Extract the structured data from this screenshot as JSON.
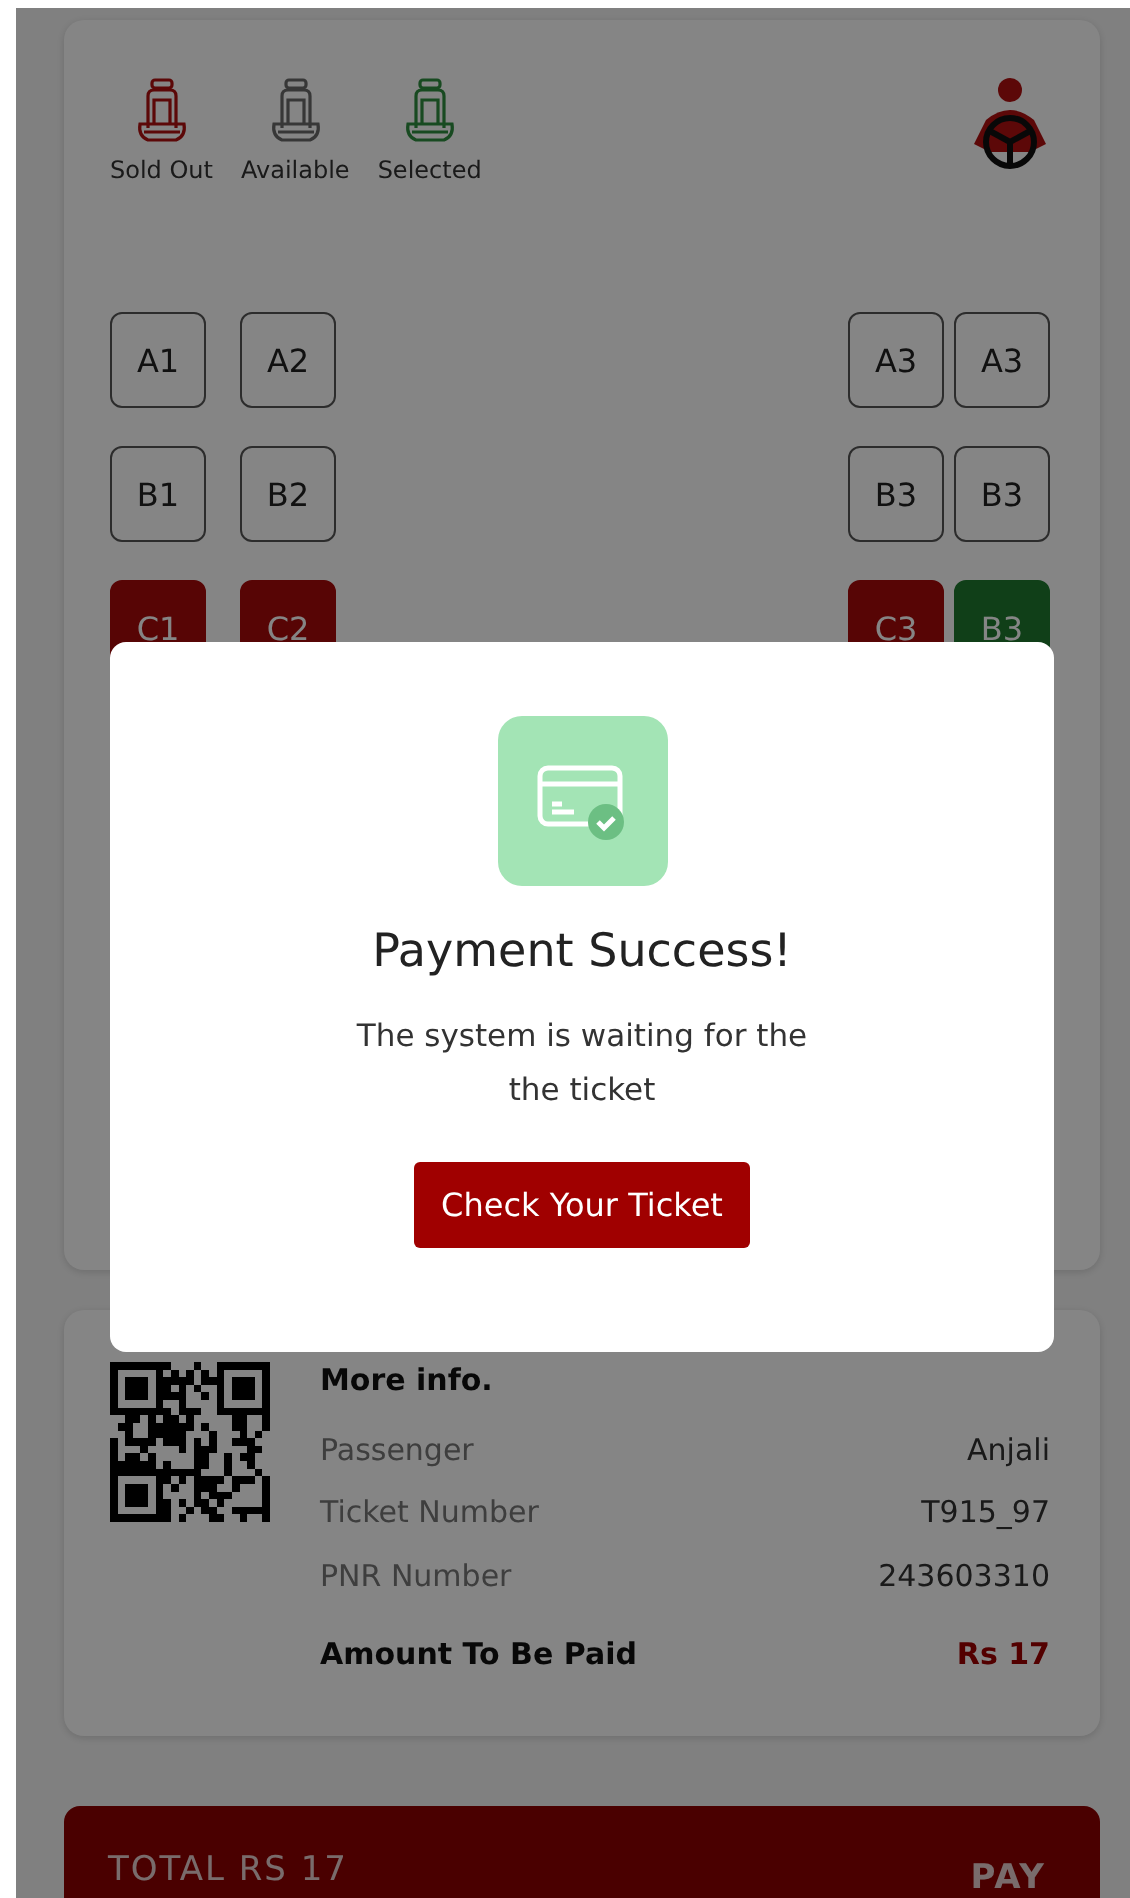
{
  "legend": [
    {
      "label": "Sold Out",
      "kind": "sold_out"
    },
    {
      "label": "Available",
      "kind": "available"
    },
    {
      "label": "Selected",
      "kind": "selected"
    }
  ],
  "seat_rows": [
    {
      "left": [
        {
          "label": "A1",
          "kind": "available"
        },
        {
          "label": "A2",
          "kind": "available"
        }
      ],
      "right": [
        {
          "label": "A3",
          "kind": "available"
        },
        {
          "label": "A3",
          "kind": "available"
        }
      ]
    },
    {
      "left": [
        {
          "label": "B1",
          "kind": "available"
        },
        {
          "label": "B2",
          "kind": "available"
        }
      ],
      "right": [
        {
          "label": "B3",
          "kind": "available"
        },
        {
          "label": "B3",
          "kind": "available"
        }
      ]
    },
    {
      "left": [
        {
          "label": "C1",
          "kind": "sold_out"
        },
        {
          "label": "C2",
          "kind": "sold_out"
        }
      ],
      "right": [
        {
          "label": "C3",
          "kind": "sold_out"
        },
        {
          "label": "B3",
          "kind": "selected"
        }
      ]
    }
  ],
  "modal": {
    "title": "Payment Success!",
    "message": "The system is waiting for the the ticket",
    "button": "Check Your Ticket"
  },
  "ticket": {
    "heading": "More info.",
    "rows": [
      {
        "label": "Passenger",
        "value": "Anjali"
      },
      {
        "label": "Ticket Number",
        "value": "T915_97"
      },
      {
        "label": "PNR Number",
        "value": "243603310"
      }
    ],
    "amount_label": "Amount To Be Paid",
    "amount": "Rs 17"
  },
  "pay_bar": {
    "total": "TOTAL RS 17",
    "button": "PAY"
  }
}
